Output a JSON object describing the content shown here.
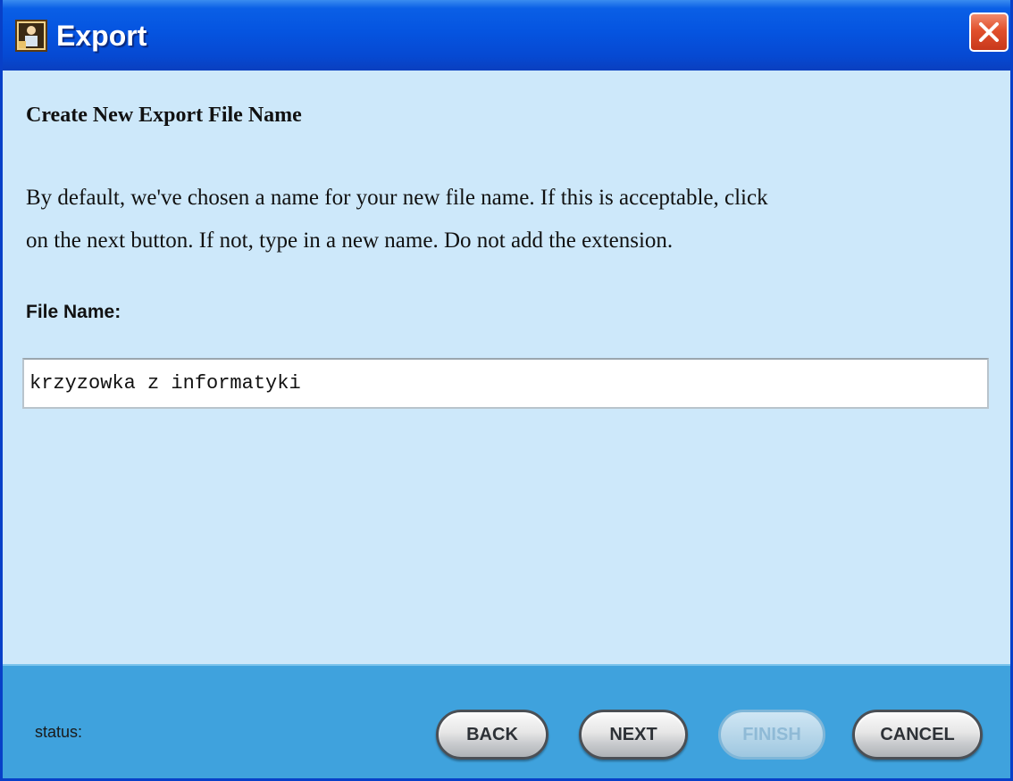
{
  "window": {
    "title": "Export",
    "icon": "app-person-icon",
    "close_icon": "close-x-icon"
  },
  "content": {
    "heading": "Create New Export File Name",
    "description_lines": [
      "By default, we've chosen a name for your new file name.  If this is acceptable, click",
      "on the next button.  If not, type in a new name. Do not add the extension."
    ],
    "file_name_label": "File Name:",
    "file_name_value": "krzyzowka z informatyki"
  },
  "footer": {
    "status_label": "status:",
    "buttons": {
      "back": "BACK",
      "next": "NEXT",
      "finish": "FINISH",
      "cancel": "CANCEL"
    }
  },
  "colors": {
    "titlebar": "#0554e0",
    "content_bg": "#cde8fa",
    "footer_bg": "#3fa2dd",
    "close_button": "#e1502c"
  }
}
